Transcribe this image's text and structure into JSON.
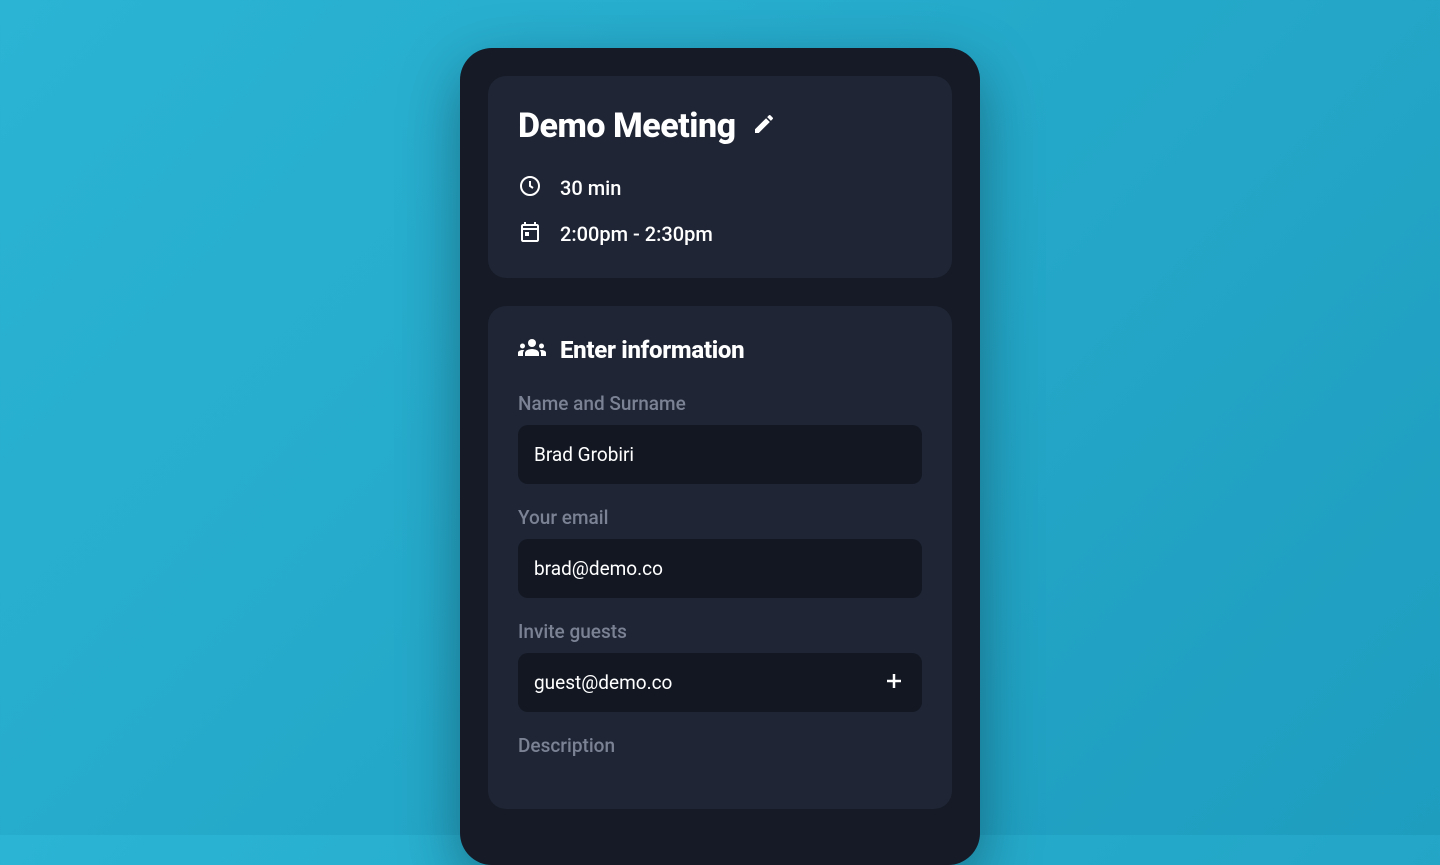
{
  "meeting": {
    "title": "Demo Meeting",
    "duration": "30 min",
    "time_range": "2:00pm - 2:30pm"
  },
  "form": {
    "section_title": "Enter information",
    "name": {
      "label": "Name and Surname",
      "value": "Brad Grobiri"
    },
    "email": {
      "label": "Your email",
      "value": "brad@demo.co"
    },
    "guests": {
      "label": "Invite guests",
      "value": "guest@demo.co"
    },
    "description": {
      "label": "Description",
      "value": ""
    }
  }
}
